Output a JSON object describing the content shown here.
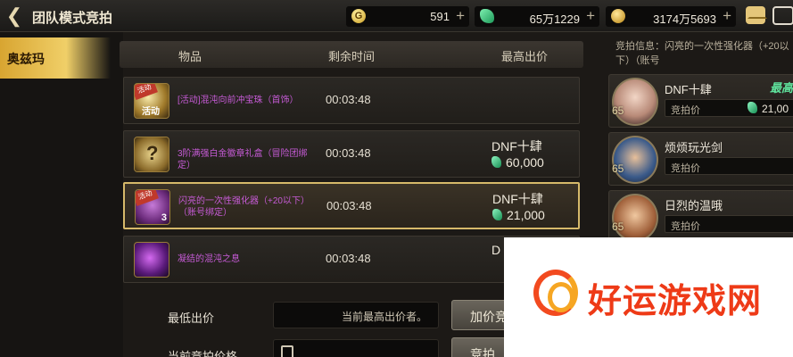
{
  "header": {
    "title": "团队模式竞拍",
    "currency": [
      {
        "icon": "gold-coin-icon",
        "symbol": "G",
        "value": "591"
      },
      {
        "icon": "green-gem-icon",
        "value": "65万1229"
      },
      {
        "icon": "gold-medal-icon",
        "value": "3174万5693"
      }
    ],
    "plus": "+"
  },
  "sidebar": {
    "items": [
      {
        "label": "奥兹玛"
      }
    ]
  },
  "table": {
    "headers": [
      "物品",
      "剩余时间",
      "最高出价"
    ],
    "rows": [
      {
        "name": "[活动]混沌向前冲宝珠（首饰）",
        "time": "00:03:48",
        "bidder": "",
        "bid": "",
        "ribbon": "活动",
        "icon_text": "活动",
        "qty": ""
      },
      {
        "name": "3阶满强白金徽章礼盒（冒险团绑定）",
        "time": "00:03:48",
        "bidder": "DNF十肆",
        "bid": "60,000",
        "ribbon": "",
        "icon_text": "?",
        "qty": ""
      },
      {
        "name": "闪亮的一次性强化器（+20以下）（账号绑定）",
        "time": "00:03:48",
        "bidder": "DNF十肆",
        "bid": "21,000",
        "ribbon": "活动",
        "icon_text": "",
        "qty": "3"
      },
      {
        "name": "凝结的混沌之息",
        "time": "00:03:48",
        "bidder": "D",
        "bid": "",
        "ribbon": "",
        "icon_text": "",
        "qty": ""
      }
    ]
  },
  "info": {
    "text": "竞拍信息：闪亮的一次性强化器（+20以下）（账号"
  },
  "bidders": [
    {
      "name": "DNF十肆",
      "level": "65",
      "label": "竞拍价",
      "value": "21,00",
      "tag": "最高"
    },
    {
      "name": "烦烦玩光剑",
      "level": "65",
      "label": "竞拍价",
      "value": "",
      "tag": ""
    },
    {
      "name": "日烈的温哦",
      "level": "65",
      "label": "竞拍价",
      "value": "",
      "tag": ""
    }
  ],
  "form": {
    "min_label": "最低出价",
    "min_value": "当前最高出价者。",
    "cur_label": "当前竞拍价格",
    "btn_add": "加价竞",
    "btn_bid": "竞拍"
  },
  "watermark": {
    "text": "好运游戏网"
  },
  "colors": {
    "accent_gold": "#d8a531",
    "item_purple": "#c65bd6",
    "gem_green": "#5fe39d",
    "watermark_red": "#ee3a17"
  }
}
